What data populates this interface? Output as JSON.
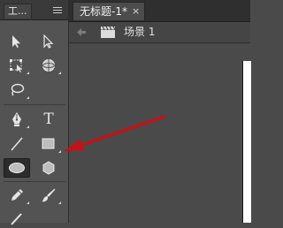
{
  "toolbar": {
    "title": "工...",
    "tools": [
      {
        "name": "selection-tool",
        "icon": "selection-arrow-icon"
      },
      {
        "name": "subselection-tool",
        "icon": "subselection-arrow-icon"
      },
      {
        "name": "free-transform-tool",
        "icon": "free-transform-icon"
      },
      {
        "name": "3d-rotation-tool",
        "icon": "3d-rotation-icon"
      },
      {
        "name": "lasso-tool",
        "icon": "lasso-icon"
      },
      {
        "name": "pen-tool",
        "icon": "pen-icon"
      },
      {
        "name": "text-tool",
        "icon": "text-icon",
        "label": "T"
      },
      {
        "name": "line-tool",
        "icon": "line-icon"
      },
      {
        "name": "rectangle-tool",
        "icon": "rectangle-icon"
      },
      {
        "name": "oval-tool",
        "icon": "oval-icon",
        "active": true
      },
      {
        "name": "polystar-tool",
        "icon": "polystar-icon"
      },
      {
        "name": "pencil-tool",
        "icon": "pencil-icon"
      },
      {
        "name": "brush-tool",
        "icon": "brush-icon"
      }
    ]
  },
  "document": {
    "tab_title": "无标题-1*",
    "close_glyph": "×"
  },
  "editbar": {
    "scene_label": "场景 1"
  },
  "annotation": {
    "arrow_color": "#c0141a",
    "points_to": "rectangle-tool"
  },
  "colors": {
    "toolbar_bg": "#535353",
    "stage_bg": "#4a4a4a",
    "tab_bg": "#2f2f2f",
    "active_tool_bg": "#2c2c2c",
    "canvas": "#ffffff"
  }
}
